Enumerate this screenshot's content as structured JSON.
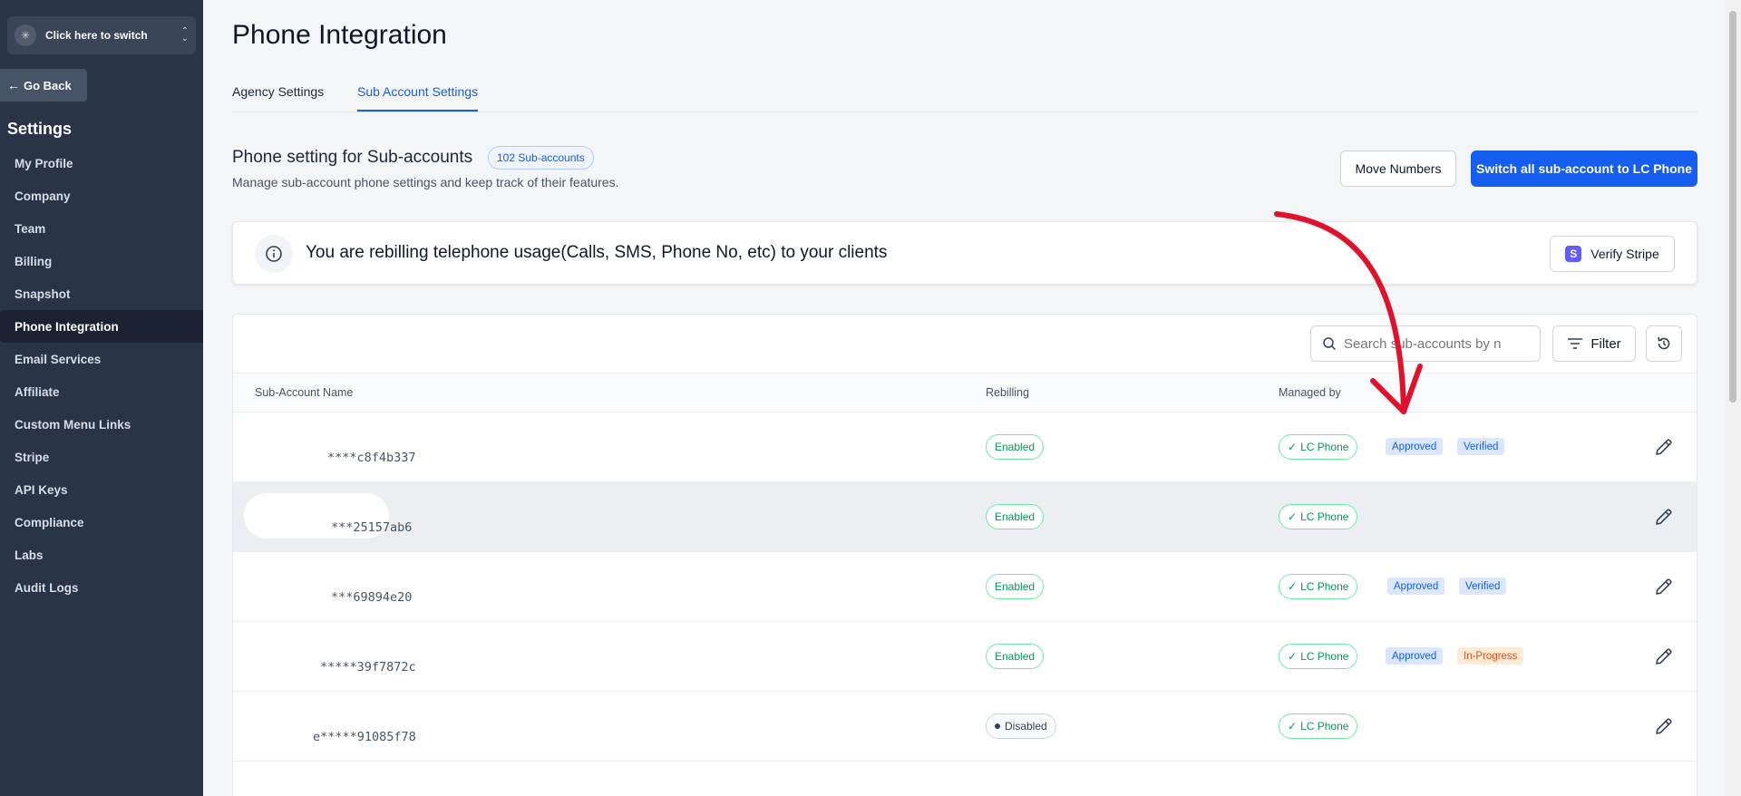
{
  "sidebar": {
    "switcher_label": "Click here to switch",
    "go_back": "Go Back",
    "title": "Settings",
    "items": [
      {
        "label": "My Profile",
        "active": false
      },
      {
        "label": "Company",
        "active": false
      },
      {
        "label": "Team",
        "active": false
      },
      {
        "label": "Billing",
        "active": false
      },
      {
        "label": "Snapshot",
        "active": false
      },
      {
        "label": "Phone Integration",
        "active": true
      },
      {
        "label": "Email Services",
        "active": false
      },
      {
        "label": "Affiliate",
        "active": false
      },
      {
        "label": "Custom Menu Links",
        "active": false
      },
      {
        "label": "Stripe",
        "active": false
      },
      {
        "label": "API Keys",
        "active": false
      },
      {
        "label": "Compliance",
        "active": false
      },
      {
        "label": "Labs",
        "active": false
      },
      {
        "label": "Audit Logs",
        "active": false
      }
    ]
  },
  "page": {
    "title": "Phone Integration",
    "tabs": [
      {
        "label": "Agency Settings",
        "active": false
      },
      {
        "label": "Sub Account Settings",
        "active": true
      }
    ]
  },
  "section": {
    "title": "Phone setting for Sub-accounts",
    "count_badge": "102 Sub-accounts",
    "subtitle": "Manage sub-account phone settings and keep track of their features.",
    "move_numbers": "Move Numbers",
    "switch_all": "Switch all sub-account to LC Phone"
  },
  "info": {
    "text": "You are rebilling telephone usage(Calls, SMS, Phone No, etc) to your clients",
    "verify_stripe": "Verify Stripe"
  },
  "table": {
    "search_placeholder": "Search sub-accounts by n",
    "filter": "Filter",
    "headers": {
      "name": "Sub-Account Name",
      "rebilling": "Rebilling",
      "managed_by": "Managed by"
    },
    "rows": [
      {
        "account": "****c8f4b337",
        "rebilling": "Enabled",
        "managed_by": "LC Phone",
        "tags": [
          "Approved",
          "Verified"
        ]
      },
      {
        "account": "***25157ab6",
        "rebilling": "Enabled",
        "managed_by": "LC Phone",
        "tags": []
      },
      {
        "account": "***69894e20",
        "rebilling": "Enabled",
        "managed_by": "LC Phone",
        "tags": [
          "Approved",
          "Verified"
        ]
      },
      {
        "account": "*****39f7872c",
        "rebilling": "Enabled",
        "managed_by": "LC Phone",
        "tags": [
          "Approved",
          "In-Progress"
        ]
      },
      {
        "account": "e*****91085f78",
        "rebilling": "Disabled",
        "managed_by": "LC Phone",
        "tags": []
      }
    ]
  },
  "colors": {
    "sidebar_bg": "#2a3447",
    "primary": "#155eef",
    "success": "#039855",
    "annotation": "#e0112b"
  }
}
